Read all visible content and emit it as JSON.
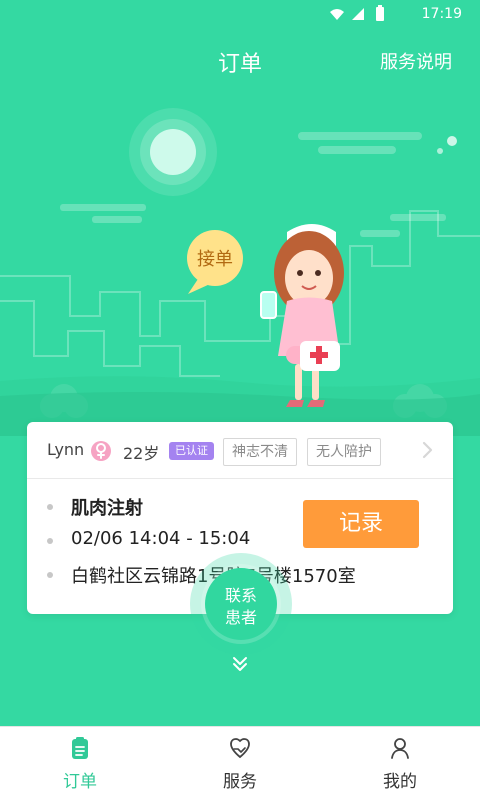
{
  "status_bar": {
    "time": "17:19"
  },
  "header": {
    "title": "订单",
    "action": "服务说明"
  },
  "scene": {
    "bubble_text": "接单"
  },
  "order": {
    "patient_name": "Lynn",
    "age": "22岁",
    "verified": "已认证",
    "tags": [
      "神志不清",
      "无人陪护"
    ],
    "service": "肌肉注射",
    "time_range": "02/06 14:04 - 15:04",
    "address": "白鹤社区云锦路1号院7号楼1570室",
    "record_button": "记录"
  },
  "contact": {
    "line1": "联系",
    "line2": "患者"
  },
  "tabbar": {
    "tabs": [
      {
        "label": "订单",
        "icon": "clipboard-icon",
        "active": true
      },
      {
        "label": "服务",
        "icon": "heart-hand-icon",
        "active": false
      },
      {
        "label": "我的",
        "icon": "user-icon",
        "active": false
      }
    ]
  },
  "colors": {
    "primary": "#34d9a2",
    "accent": "#ff9b3a",
    "verified": "#a483f0",
    "tab_active": "#31c997"
  }
}
